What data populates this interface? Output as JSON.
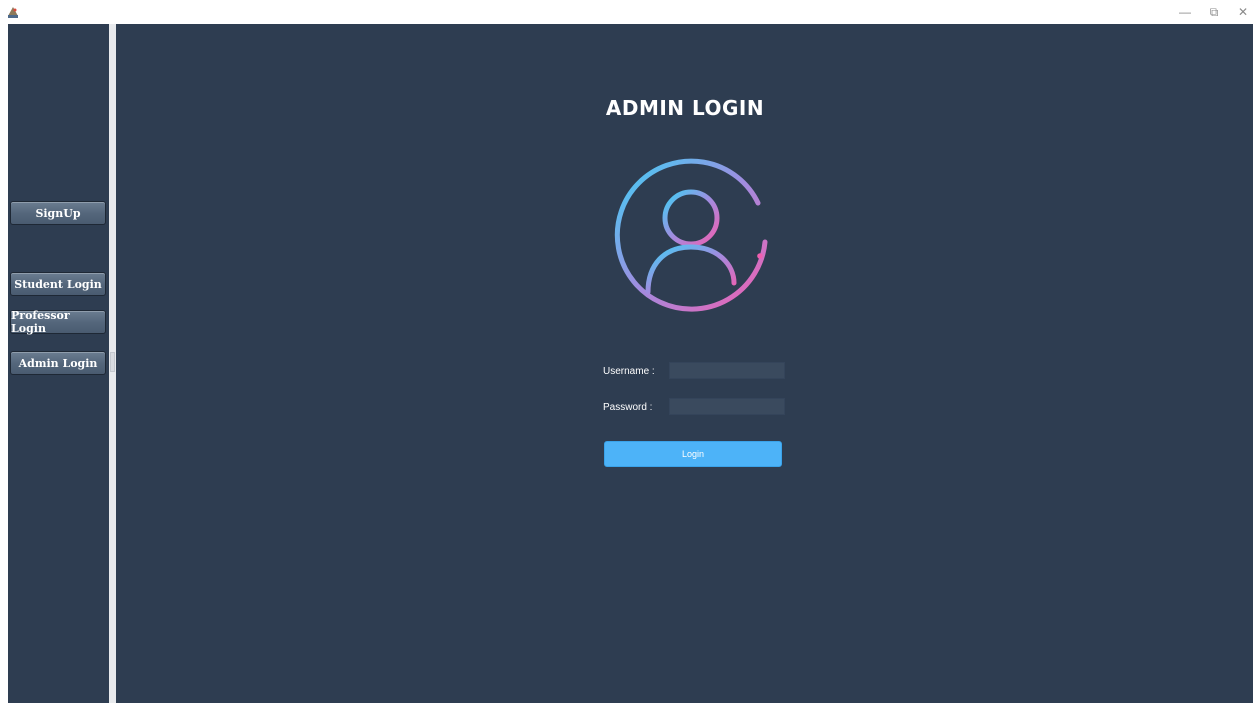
{
  "window": {
    "controls": {
      "minimize": "—",
      "maximize": "⧉",
      "close": "✕"
    }
  },
  "sidebar": {
    "items": [
      {
        "label": "SignUp"
      },
      {
        "label": "Student Login"
      },
      {
        "label": "Professor Login"
      },
      {
        "label": "Admin Login"
      }
    ]
  },
  "main": {
    "title": "ADMIN LOGIN",
    "avatar_icon": "user-circle-icon",
    "username_label": "Username :",
    "username_value": "",
    "password_label": "Password :",
    "password_value": "",
    "login_label": "Login"
  },
  "colors": {
    "panel_bg": "#2e3d51",
    "accent": "#4db3f8",
    "gradient_start": "#3fd0f5",
    "gradient_end": "#f05fb0"
  }
}
